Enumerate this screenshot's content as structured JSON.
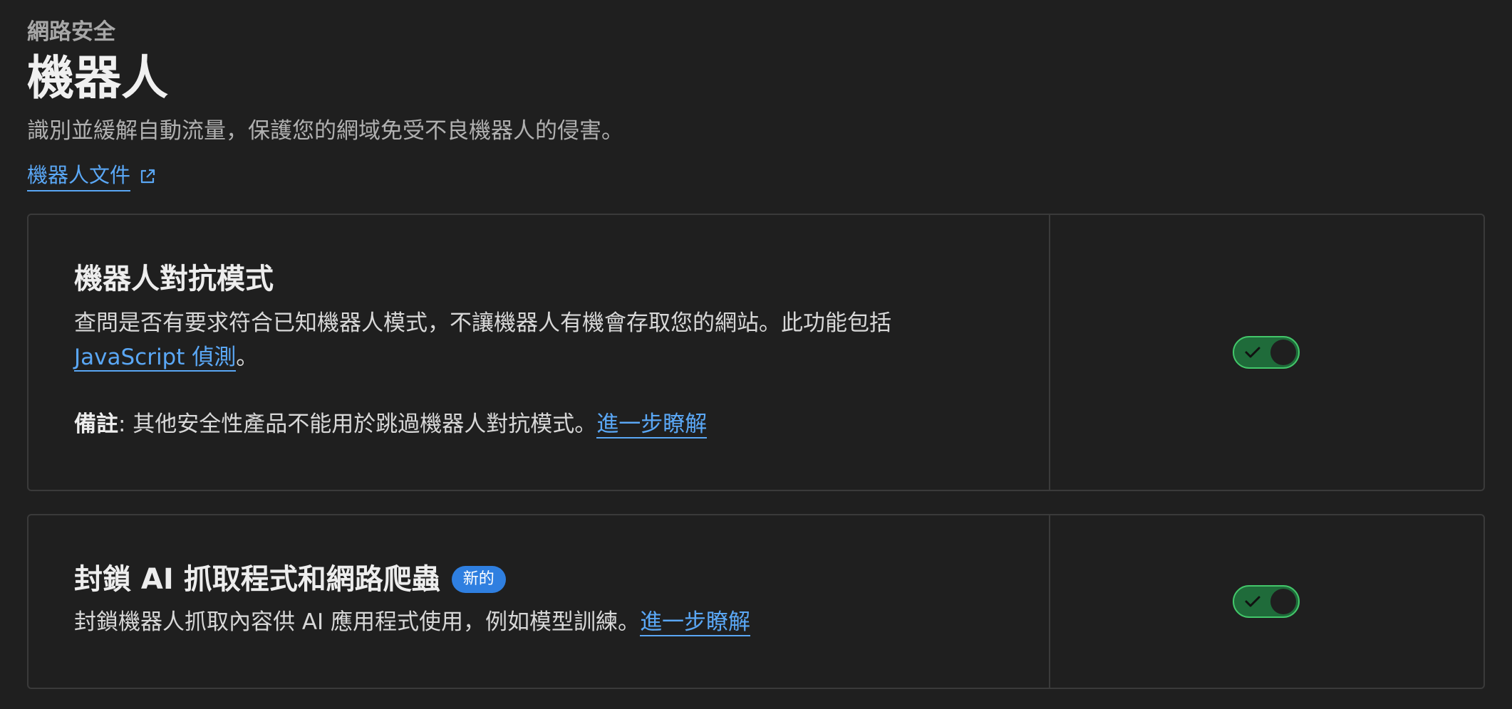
{
  "header": {
    "breadcrumb": "網路安全",
    "title": "機器人",
    "description": "識別並緩解自動流量，保護您的網域免受不良機器人的侵害。",
    "doc_link": "機器人文件"
  },
  "cards": [
    {
      "title": "機器人對抗模式",
      "text_before_link": "查問是否有要求符合已知機器人模式，不讓機器人有機會存取您的網站。此功能包括",
      "link": "JavaScript 偵測",
      "text_after_link": "。",
      "note_label": "備註",
      "note_text": ": 其他安全性產品不能用於跳過機器人對抗模式。",
      "learn_more": "進一步瞭解",
      "toggle_on": true
    },
    {
      "title": "封鎖 AI 抓取程式和網路爬蟲",
      "badge": "新的",
      "text": "封鎖機器人抓取內容供 AI 應用程式使用，例如模型訓練。",
      "learn_more": "進一步瞭解",
      "toggle_on": true
    }
  ],
  "colors": {
    "accent_link": "#5aa7f5",
    "toggle_on_border": "#43c76a",
    "toggle_on_bg": "#1f6b3a",
    "badge_bg": "#2f7fe0"
  },
  "icons": {
    "doc_link": "external-link-icon",
    "toggle": "check-icon"
  }
}
